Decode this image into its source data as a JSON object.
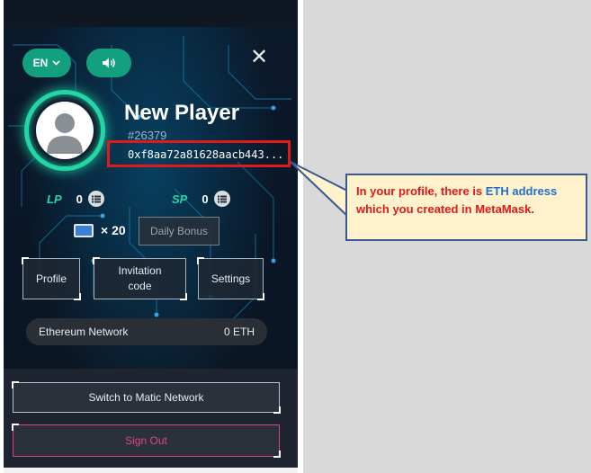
{
  "header": {
    "language": "EN"
  },
  "profile": {
    "name": "New Player",
    "id": "#26379",
    "eth_address": "0xf8aa72a81628aacb443..."
  },
  "stats": {
    "lp_label": "LP",
    "lp_value": "0",
    "sp_label": "SP",
    "sp_value": "0"
  },
  "bonus": {
    "ticket_count": "× 20",
    "daily_bonus_label": "Daily Bonus"
  },
  "menu": {
    "profile_label": "Profile",
    "invitation_label_line1": "Invitation",
    "invitation_label_line2": "code",
    "settings_label": "Settings"
  },
  "network": {
    "name": "Ethereum Network",
    "balance": "0 ETH"
  },
  "actions": {
    "switch_label": "Switch to Matic Network",
    "signout_label": "Sign Out"
  },
  "callout": {
    "part1": "In your profile, there is ",
    "highlight": "ETH address",
    "part2": " which you created in MetaMask."
  },
  "colors": {
    "accent_green": "#12a07e",
    "avatar_ring": "#22d6a6",
    "highlight_red": "#e01a1a",
    "signout_pink": "#e0477f",
    "callout_bg": "#fff2cc",
    "callout_text": "#e01818",
    "eth_blue": "#1f6fd0"
  },
  "icons": {
    "language": "chevron-down-icon",
    "sound": "speaker-icon",
    "close": "close-icon",
    "avatar": "user-silhouette-icon",
    "info": "list-icon",
    "ticket": "ticket-icon"
  }
}
